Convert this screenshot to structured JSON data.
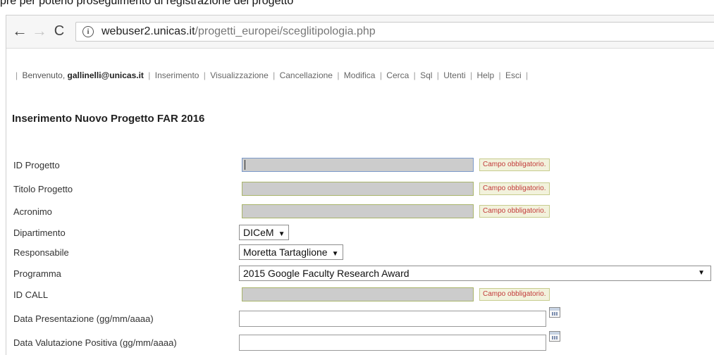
{
  "top_text": "pre per poterlo proseguimento di registrazione del progetto",
  "browser": {
    "back_icon": "←",
    "forward_icon": "→",
    "reload_icon": "C",
    "url_host": "webuser2.unicas.it",
    "url_path": "/progetti_europei/sceglitipologia.php"
  },
  "menu": {
    "welcome": "Benvenuto,",
    "user": "gallinelli@unicas.it",
    "items": [
      "Inserimento",
      "Visualizzazione",
      "Cancellazione",
      "Modifica",
      "Cerca",
      "Sql",
      "Utenti",
      "Help",
      "Esci"
    ]
  },
  "page_title": "Inserimento Nuovo Progetto FAR 2016",
  "required_text": "Campo obbligatorio.",
  "form": {
    "id_progetto": {
      "label": "ID Progetto",
      "value": ""
    },
    "titolo": {
      "label": "Titolo Progetto",
      "value": ""
    },
    "acronimo": {
      "label": "Acronimo",
      "value": ""
    },
    "dipartimento": {
      "label": "Dipartimento",
      "selected": "DICeM"
    },
    "responsabile": {
      "label": "Responsabile",
      "selected": "Moretta Tartaglione"
    },
    "programma": {
      "label": "Programma",
      "selected": "2015 Google Faculty Research Award"
    },
    "id_call": {
      "label": "ID CALL",
      "value": ""
    },
    "data_presentazione": {
      "label": "Data Presentazione (gg/mm/aaaa)",
      "value": ""
    },
    "data_valutazione": {
      "label": "Data Valutazione Positiva (gg/mm/aaaa)",
      "value": ""
    }
  }
}
